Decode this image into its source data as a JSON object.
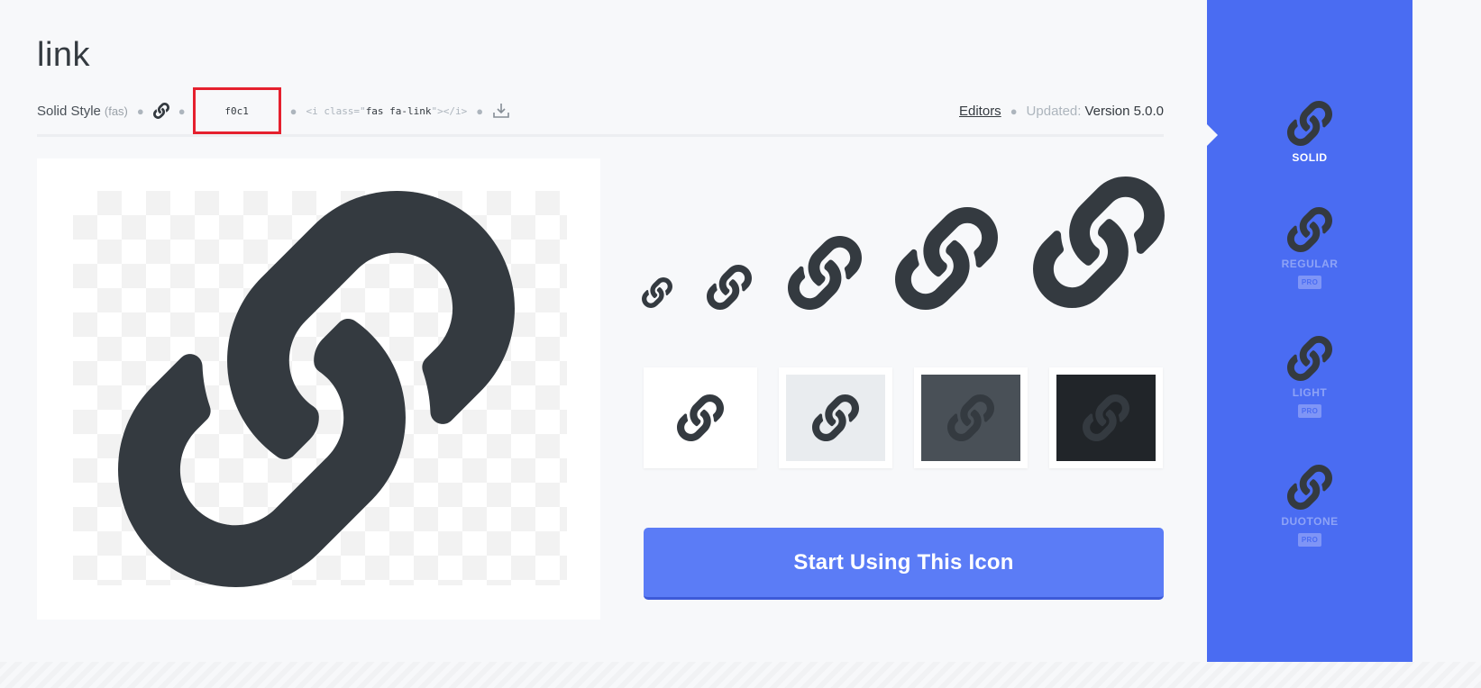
{
  "icon": {
    "title": "link",
    "style_label": "Solid Style",
    "style_prefix": "(fas)",
    "unicode": "f0c1",
    "snippet_open": "<i class=\"",
    "snippet_class": "fas fa-link",
    "snippet_close": "\"></i>",
    "editors_label": "Editors",
    "updated_label": "Updated:",
    "version": "Version 5.0.0"
  },
  "colors": {
    "accent": "#4a6cf2",
    "preview_icon": "#4a6cf2",
    "size_icon": "#adb5bd",
    "highlight_box": "#e5202e"
  },
  "swatches": [
    {
      "bg": "#ffffff",
      "fg": "#212529"
    },
    {
      "bg": "#e9ecef",
      "fg": "#495057"
    },
    {
      "bg": "#495057",
      "fg": "#ffffff"
    },
    {
      "bg": "#212529",
      "fg": "#ffffff"
    }
  ],
  "cta": {
    "label": "Start Using This Icon"
  },
  "styles": [
    {
      "label": "SOLID",
      "pro": "",
      "active": true
    },
    {
      "label": "REGULAR",
      "pro": "PRO",
      "active": false
    },
    {
      "label": "LIGHT",
      "pro": "PRO",
      "active": false
    },
    {
      "label": "DUOTONE",
      "pro": "PRO",
      "active": false
    }
  ],
  "icons": {
    "link": "link-icon",
    "download": "download-icon"
  }
}
